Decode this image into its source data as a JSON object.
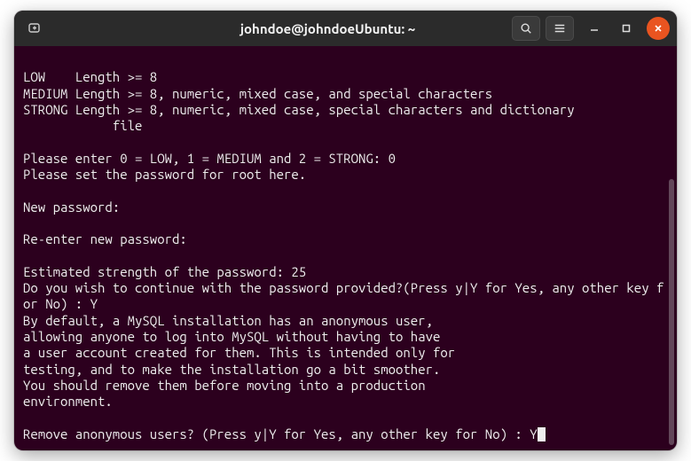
{
  "titlebar": {
    "title": "johndoe@johndoeUbuntu: ~"
  },
  "terminal": {
    "lines": [
      "",
      "LOW    Length >= 8",
      "MEDIUM Length >= 8, numeric, mixed case, and special characters",
      "STRONG Length >= 8, numeric, mixed case, special characters and dictionary",
      "            file",
      "",
      "Please enter 0 = LOW, 1 = MEDIUM and 2 = STRONG: 0",
      "Please set the password for root here.",
      "",
      "New password:",
      "",
      "Re-enter new password:",
      "",
      "Estimated strength of the password: 25",
      "Do you wish to continue with the password provided?(Press y|Y for Yes, any other key for No) : Y",
      "By default, a MySQL installation has an anonymous user,",
      "allowing anyone to log into MySQL without having to have",
      "a user account created for them. This is intended only for",
      "testing, and to make the installation go a bit smoother.",
      "You should remove them before moving into a production",
      "environment.",
      "",
      "Remove anonymous users? (Press y|Y for Yes, any other key for No) : Y"
    ]
  }
}
